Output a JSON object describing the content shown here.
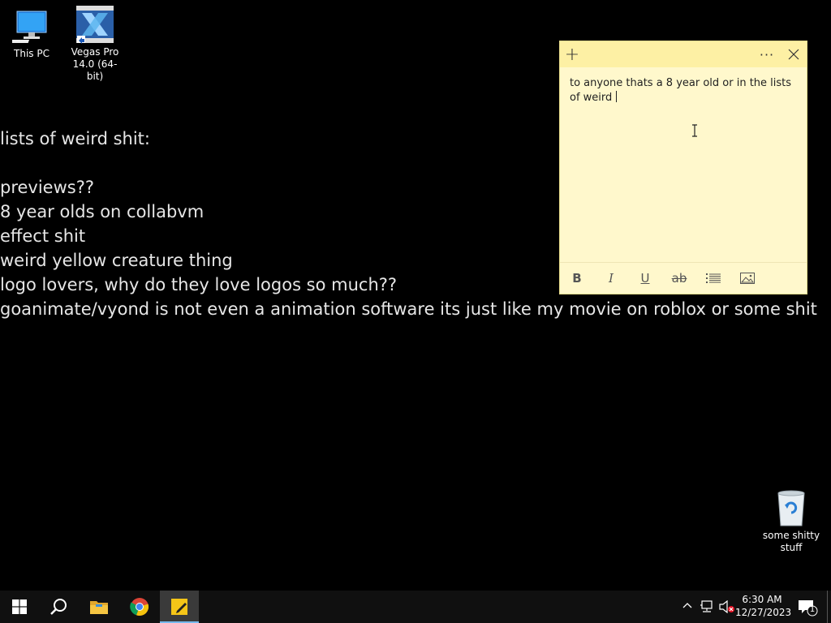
{
  "desktop": {
    "icons": [
      {
        "label": "This PC"
      },
      {
        "label": "Vegas Pro 14.0 (64-bit)"
      },
      {
        "label": "some shitty stuff"
      }
    ],
    "wallpaper_lines": [
      "lists of weird shit:",
      "",
      "previews??",
      "8 year olds on collabvm",
      "effect shit",
      "weird yellow creature thing",
      "logo lovers, why do they love logos so much??",
      "goanimate/vyond is not even a animation software its just like my movie on roblox or some shit"
    ]
  },
  "sticky_note": {
    "text": "to anyone thats a 8 year old or in the lists of weird ",
    "background": "#fff8cc",
    "titlebar_color": "#fdf0a4",
    "toolbar": [
      "bold-icon",
      "italic-icon",
      "underline-icon",
      "strikethrough-icon",
      "bullets-icon",
      "image-icon"
    ]
  },
  "taskbar": {
    "apps": [
      "start-icon",
      "search-icon",
      "file-explorer-icon",
      "chrome-icon",
      "sticky-notes-icon"
    ],
    "clock": {
      "time": "6:30 AM",
      "date": "12/27/2023"
    },
    "notification_count": "1",
    "accent": "#76b9ed"
  }
}
